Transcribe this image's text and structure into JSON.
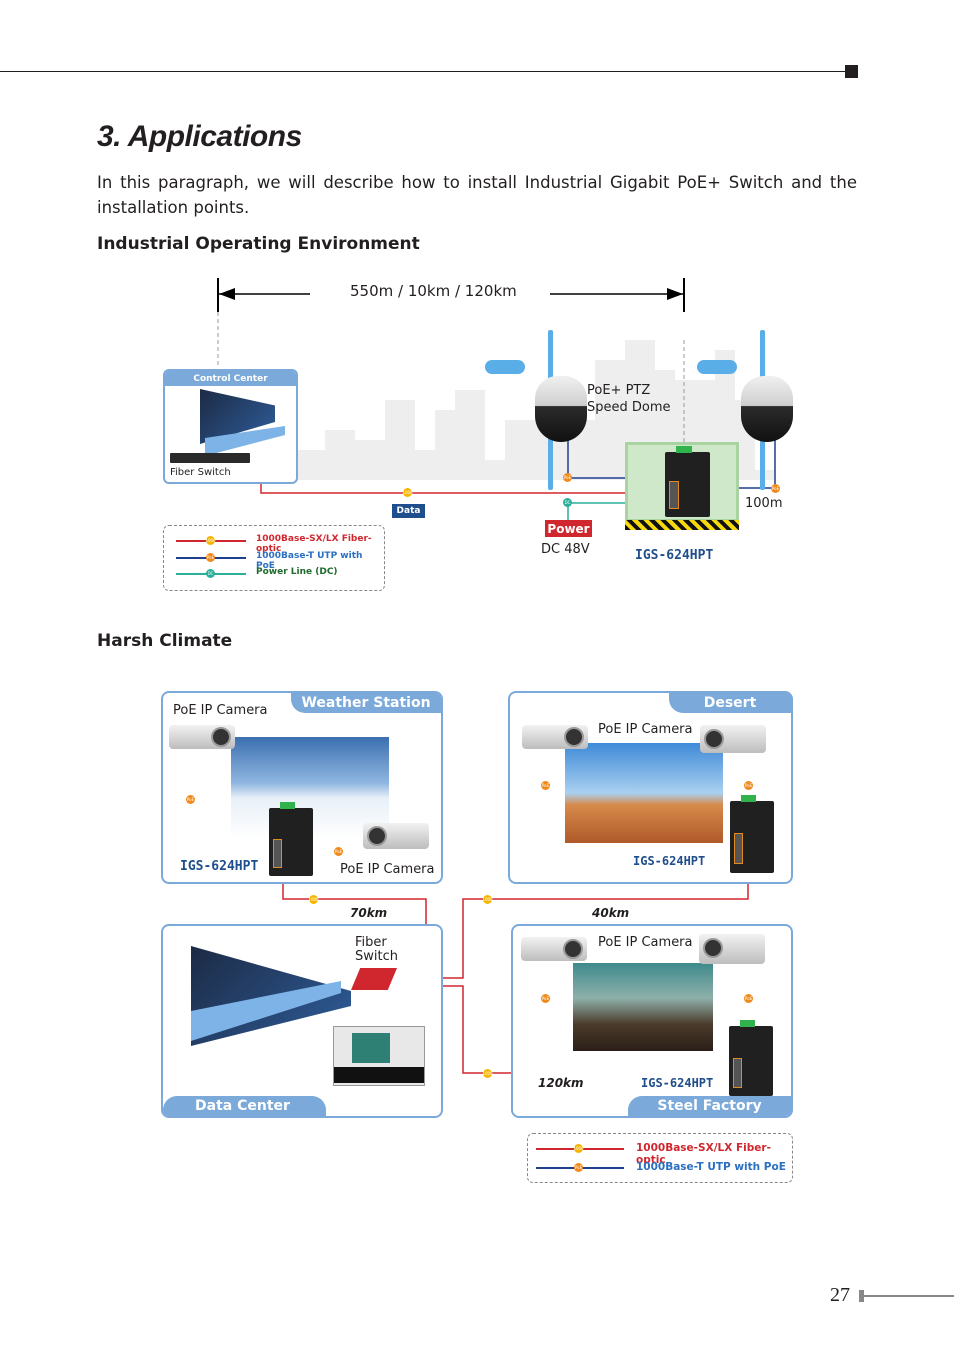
{
  "page": {
    "title": "3. Applications",
    "intro": "In this paragraph, we will describe how to install Industrial Gigabit PoE+ Switch and the installation points.",
    "page_number": "27"
  },
  "section1": {
    "heading": "Industrial Operating Environment",
    "distance_label": "550m / 10km / 120km",
    "control_center": {
      "tab_label": "Control Center",
      "fiber_switch_label": "Fiber Switch"
    },
    "camera_label_line1": "PoE+ PTZ",
    "camera_label_line2": "Speed Dome",
    "data_label": "Data",
    "power_label": "Power",
    "dc_label": "DC 48V",
    "distance_100m": "100m",
    "model": "IGS-624HPT",
    "badge_fiber": "1000",
    "badge_poe": "PoE",
    "badge_dc": "DC",
    "legend": [
      {
        "label": "1000Base-SX/LX Fiber-optic",
        "color": "#d0272e",
        "badge": "1000"
      },
      {
        "label": "1000Base-T UTP with PoE",
        "color": "#1f3f8f",
        "badge": "PoE"
      },
      {
        "label": "Power Line (DC)",
        "color": "#2bae9a",
        "badge": "DC"
      }
    ]
  },
  "section2": {
    "heading": "Harsh Climate",
    "weather_station": {
      "tab_label": "Weather Station",
      "camera1_label": "PoE IP Camera",
      "camera2_label": "PoE IP Camera",
      "model": "IGS-624HPT"
    },
    "desert": {
      "tab_label": "Desert",
      "camera_label": "PoE IP Camera",
      "model": "IGS-624HPT"
    },
    "data_center": {
      "tab_label": "Data Center",
      "fiber_switch_line1": "Fiber",
      "fiber_switch_line2": "Switch"
    },
    "steel_factory": {
      "tab_label": "Steel Factory",
      "camera_label": "PoE IP Camera",
      "model": "IGS-624HPT"
    },
    "distances": {
      "weather": "70km",
      "desert": "40km",
      "steel": "120km"
    },
    "badge_fiber": "1000",
    "badge_poe": "PoE",
    "legend": [
      {
        "label": "1000Base-SX/LX Fiber-optic",
        "color": "#d0272e",
        "badge": "1000"
      },
      {
        "label": "1000Base-T UTP with PoE",
        "color": "#1f3f8f",
        "badge": "PoE"
      }
    ]
  }
}
